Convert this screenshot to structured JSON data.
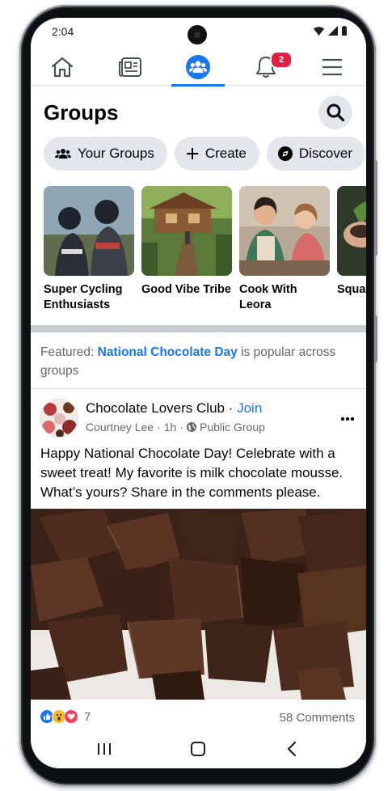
{
  "status_bar": {
    "time": "2:04"
  },
  "nav": {
    "items": [
      {
        "name": "home",
        "icon": "home-icon"
      },
      {
        "name": "news",
        "icon": "news-icon"
      },
      {
        "name": "groups",
        "icon": "groups-icon",
        "active": true
      },
      {
        "name": "notifications",
        "icon": "bell-icon",
        "badge": "2"
      },
      {
        "name": "menu",
        "icon": "hamburger-icon"
      }
    ],
    "accent_color": "#1877f2"
  },
  "header": {
    "title": "Groups",
    "search_icon": "search-icon"
  },
  "chips": [
    {
      "label": "Your Groups",
      "icon": "people-icon"
    },
    {
      "label": "Create",
      "icon": "plus-icon"
    },
    {
      "label": "Discover",
      "icon": "compass-icon"
    }
  ],
  "groups": [
    {
      "name": "Super Cycling Enthusiasts"
    },
    {
      "name": "Good Vibe Tribe"
    },
    {
      "name": "Cook With Leora"
    },
    {
      "name": "Squar Garde"
    }
  ],
  "featured": {
    "prefix": "Featured:",
    "link": "National Chocolate Day",
    "suffix": "is popular across groups"
  },
  "post": {
    "group_name": "Chocolate Lovers Club",
    "separator": " · ",
    "join_label": "Join",
    "author": "Courtney Lee",
    "time": "1h",
    "dot": "·",
    "privacy": "Public Group",
    "text": "Happy National Chocolate Day! Celebrate with a sweet treat! My favorite is milk chocolate mousse. What’s yours? Share in the comments please.",
    "reaction_count": "7",
    "comments": "58 Comments"
  }
}
